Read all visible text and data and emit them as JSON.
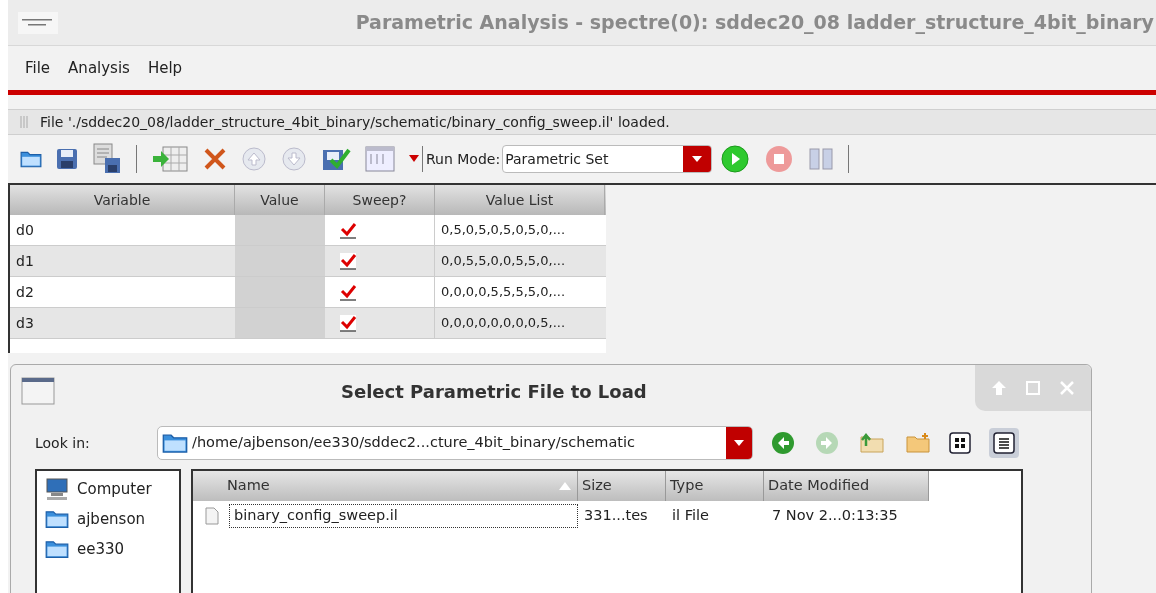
{
  "window": {
    "title": "Parametric Analysis - spectre(0): sddec20_08 ladder_structure_4bit_binary"
  },
  "menu": [
    "File",
    "Analysis",
    "Help"
  ],
  "status": "File './sddec20_08/ladder_structure_4bit_binary/schematic/binary_config_sweep.il' loaded.",
  "toolbar": {
    "run_mode_label": "Run Mode:",
    "run_mode": "Parametric Set"
  },
  "table": {
    "columns": [
      "Variable",
      "Value",
      "Sweep?",
      "Value List"
    ],
    "rows": [
      {
        "variable": "d0",
        "value": "",
        "sweep": true,
        "value_list": "0,5,0,5,0,5,0,5,0,..."
      },
      {
        "variable": "d1",
        "value": "",
        "sweep": true,
        "value_list": "0,0,5,5,0,0,5,5,0,..."
      },
      {
        "variable": "d2",
        "value": "",
        "sweep": true,
        "value_list": "0,0,0,0,5,5,5,5,0,..."
      },
      {
        "variable": "d3",
        "value": "",
        "sweep": true,
        "value_list": "0,0,0,0,0,0,0,0,5,..."
      }
    ]
  },
  "dialog": {
    "title": "Select Parametric File to Load",
    "look_in_label": "Look in:",
    "look_in": "/home/ajbenson/ee330/sddec2...cture_4bit_binary/schematic",
    "view_modes": [
      {
        "kind": "icons",
        "selected": false
      },
      {
        "kind": "details",
        "selected": true
      }
    ],
    "places": [
      {
        "kind": "computer",
        "label": "Computer"
      },
      {
        "kind": "folder",
        "label": "ajbenson"
      },
      {
        "kind": "folder",
        "label": "ee330"
      }
    ],
    "columns": [
      "Name",
      "Size",
      "Type",
      "Date Modified"
    ],
    "files": [
      {
        "name": "binary_config_sweep.il",
        "size": "331...tes",
        "type": "il File",
        "date": "7 Nov 2...0:13:35",
        "focused": true
      }
    ]
  }
}
